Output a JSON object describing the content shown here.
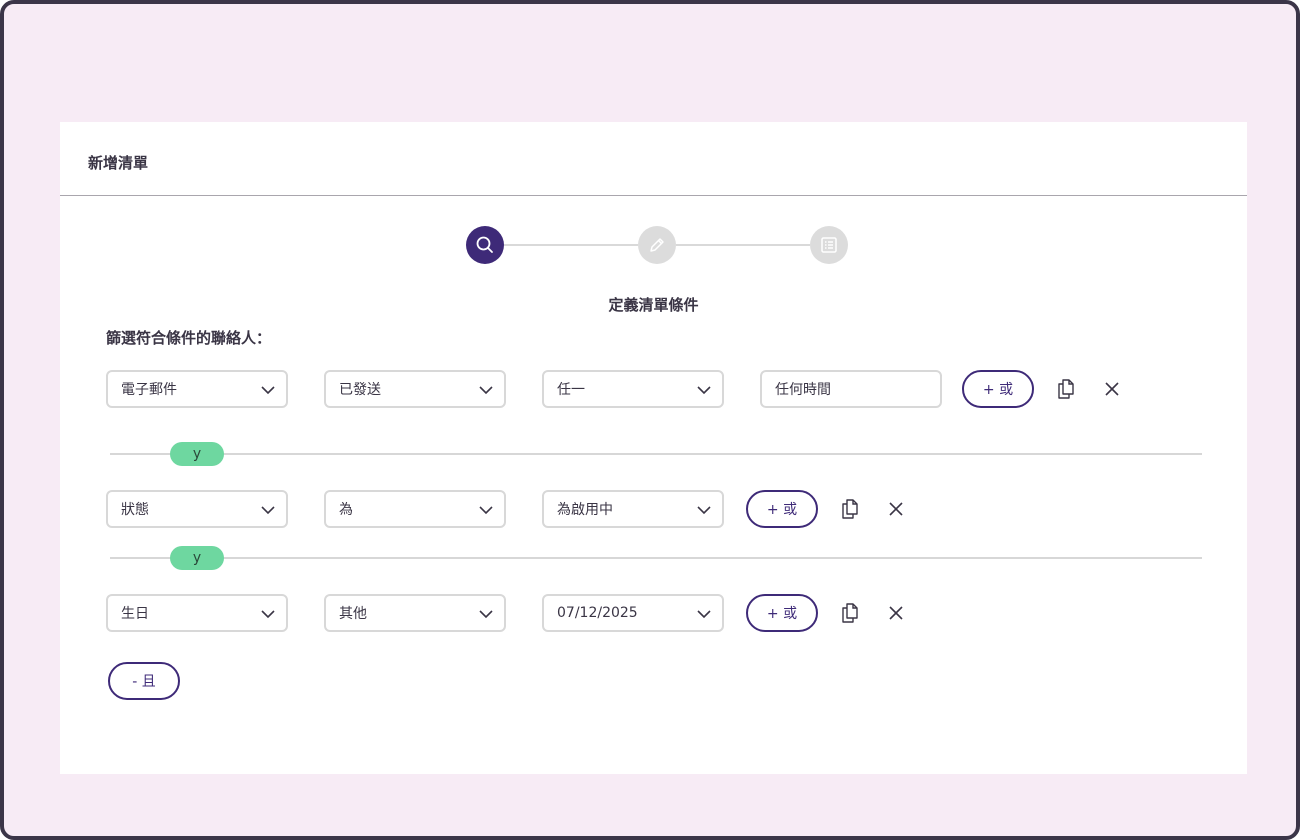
{
  "dialog": {
    "title": "新增清單"
  },
  "stepper": {
    "steps": [
      {
        "icon": "search-icon",
        "state": "active"
      },
      {
        "icon": "pencil-icon",
        "state": "inactive"
      },
      {
        "icon": "list-icon",
        "state": "inactive"
      }
    ],
    "current_label": "定義清單條件"
  },
  "filter": {
    "label": "篩選符合條件的聯絡人：",
    "rows": [
      {
        "field": "電子郵件",
        "operator": "已發送",
        "value": "任一",
        "extra": "任何時間",
        "or_label": "+ 或"
      },
      {
        "field": "狀態",
        "operator": "為",
        "value": "為啟用中",
        "or_label": "+ 或"
      },
      {
        "field": "生日",
        "operator": "其他",
        "value": "07/12/2025",
        "or_label": "+ 或"
      }
    ],
    "connectors": [
      "y",
      "y"
    ],
    "and_button": "- 且"
  },
  "colors": {
    "accent": "#3e2a78",
    "connector": "#6ed7a0",
    "frame": "#3b3548",
    "background": "#f7ebf5"
  }
}
